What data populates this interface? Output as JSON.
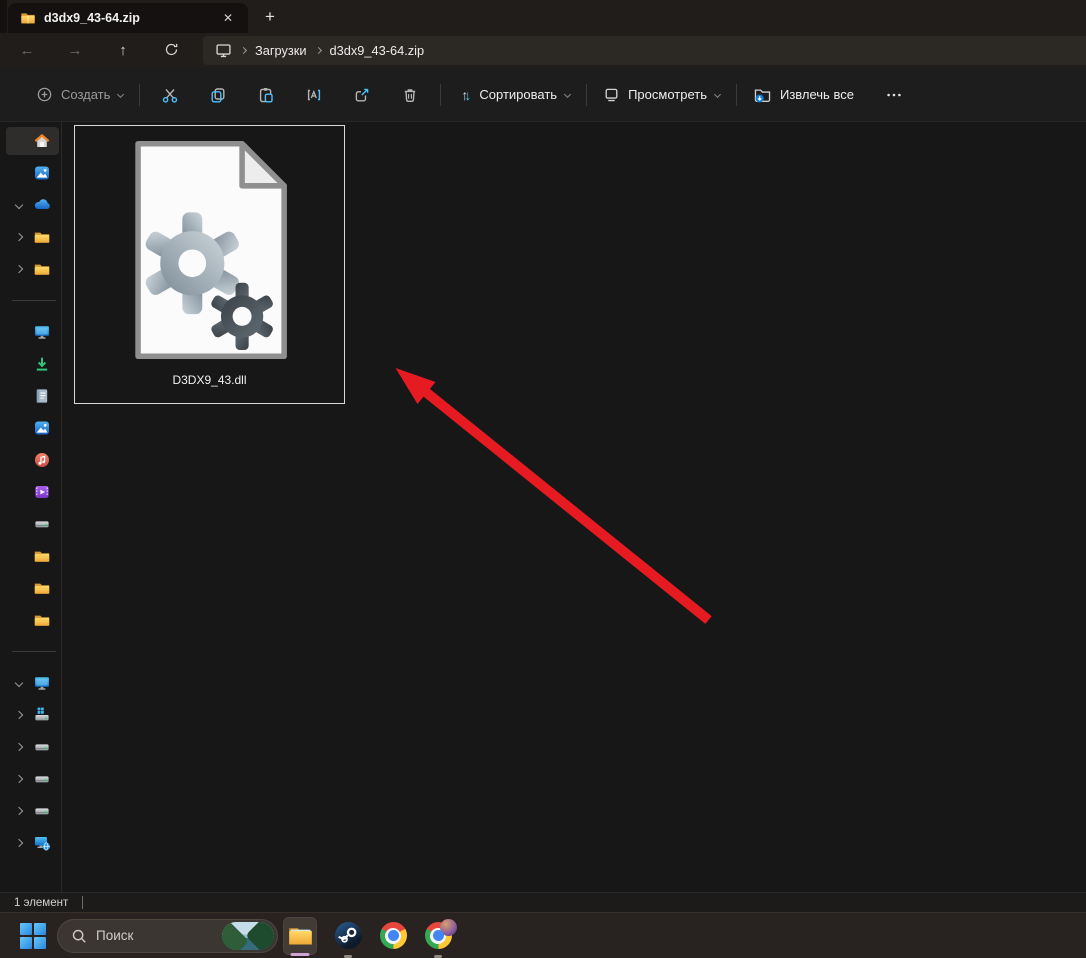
{
  "window": {
    "tab_title": "d3dx9_43-64.zip",
    "tab_icon": "zip-folder-icon",
    "close_glyph": "✕",
    "new_tab_glyph": "+"
  },
  "navigation": {
    "back_glyph": "←",
    "forward_glyph": "→",
    "up_glyph": "↑",
    "refresh_icon": "refresh-icon",
    "breadcrumb": {
      "root_icon": "this-pc-icon",
      "crumbs": [
        "Загрузки",
        "d3dx9_43-64.zip"
      ]
    }
  },
  "toolbar": {
    "create_label": "Создать",
    "sort_label": "Сортировать",
    "view_label": "Просмотреть",
    "extract_label": "Извлечь все",
    "sort_up_glyph": "↑",
    "sort_down_glyph": "↓",
    "icon_buttons": [
      "cut-icon",
      "copy-icon",
      "paste-icon",
      "rename-icon",
      "share-icon",
      "delete-icon"
    ],
    "more_icon": "more-ellipsis-icon"
  },
  "sidebar": {
    "items": [
      {
        "icon": "home-icon",
        "selected": true
      },
      {
        "icon": "gallery-icon"
      },
      {
        "icon": "onedrive-icon",
        "expanded": true
      },
      {
        "icon": "folder-icon",
        "expandable": true
      },
      {
        "icon": "folder-icon",
        "expandable": true
      },
      {
        "icon": "desktop-icon"
      },
      {
        "icon": "downloads-icon"
      },
      {
        "icon": "documents-icon"
      },
      {
        "icon": "pictures-icon"
      },
      {
        "icon": "music-icon"
      },
      {
        "icon": "videos-icon"
      },
      {
        "icon": "drive-icon"
      },
      {
        "icon": "folder-icon"
      },
      {
        "icon": "folder-icon"
      },
      {
        "icon": "folder-icon"
      },
      {
        "icon": "this-pc-icon",
        "expanded": true
      },
      {
        "icon": "windows-drive-icon",
        "expandable": true
      },
      {
        "icon": "drive-icon",
        "expandable": true
      },
      {
        "icon": "drive-icon",
        "expandable": true
      },
      {
        "icon": "drive-icon",
        "expandable": true
      },
      {
        "icon": "network-icon",
        "expandable": true
      }
    ]
  },
  "content": {
    "files": [
      {
        "name": "D3DX9_43.dll",
        "icon": "dll-gears-file-icon",
        "selected": true
      }
    ],
    "annotation": {
      "type": "red-arrow",
      "color": "#e61b22"
    }
  },
  "statusbar": {
    "items_count": "1 элемент"
  },
  "taskbar": {
    "start_icon": "windows-start-icon",
    "search_placeholder": "Поиск",
    "apps": [
      "file-explorer",
      "steam",
      "chrome",
      "chrome-profile"
    ],
    "active_app": "file-explorer"
  },
  "colors": {
    "accent_blue": "#4cc2ff",
    "arrow_red": "#e61b22",
    "taskbar_bg": "#282320",
    "titlebar_bg": "#211d1a"
  }
}
